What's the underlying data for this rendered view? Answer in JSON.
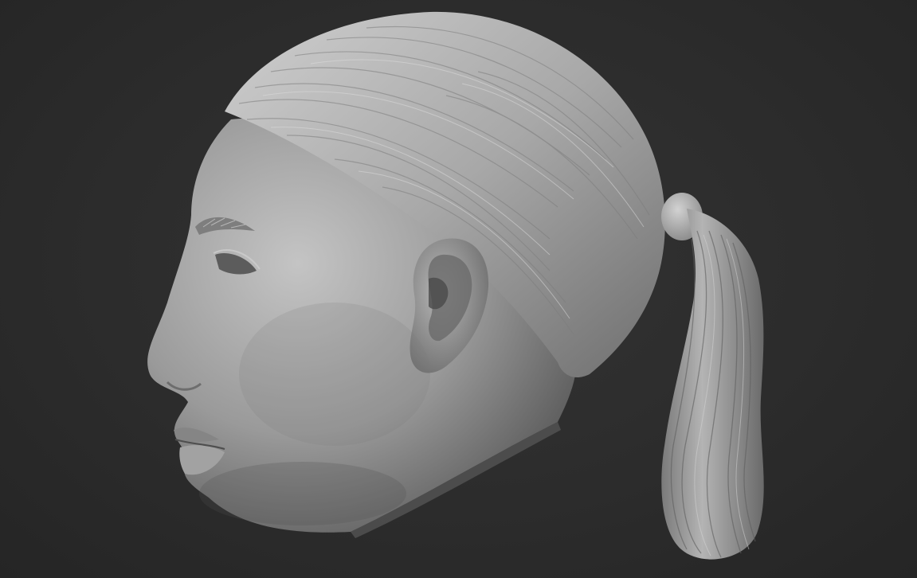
{
  "scene": {
    "subject": "sculpted-head-with-ponytail",
    "colors": {
      "background": "#2b2b2b",
      "clay_light": "#bdbdbd",
      "clay_mid": "#8f8f8f",
      "clay_dark": "#555555"
    }
  }
}
